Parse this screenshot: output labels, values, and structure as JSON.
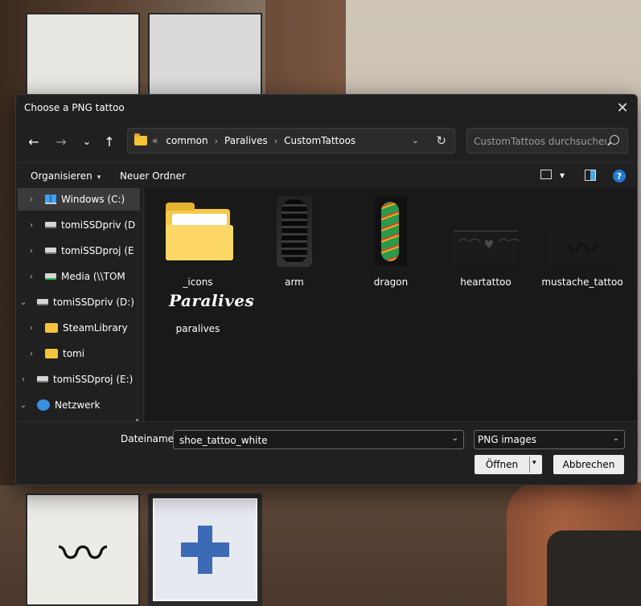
{
  "dialog": {
    "title": "Choose a PNG tattoo",
    "close_glyph": "✕"
  },
  "nav": {
    "back_glyph": "←",
    "forward_glyph": "→",
    "recent_glyph": "⌄",
    "up_glyph": "↑",
    "overflow": "«",
    "breadcrumb": [
      "common",
      "Paralives",
      "CustomTattoos"
    ],
    "breadcrumb_sep": "›",
    "refresh_glyph": "↻",
    "dropdown_glyph": "⌄",
    "search_placeholder": "CustomTattoos durchsuchen"
  },
  "toolbar": {
    "organize": "Organisieren",
    "new_folder": "Neuer Ordner",
    "caret": "▾"
  },
  "sidebar": {
    "items": [
      {
        "label": "Windows (C:)",
        "icon": "windows-drive-icon",
        "expander": "›"
      },
      {
        "label": "tomiSSDpriv (D",
        "icon": "drive-icon",
        "expander": "›"
      },
      {
        "label": "tomiSSDproj (E",
        "icon": "drive-icon",
        "expander": "›"
      },
      {
        "label": "Media (\\\\TOM",
        "icon": "network-drive-icon",
        "expander": "›"
      },
      {
        "label": "tomiSSDpriv (D:)",
        "icon": "drive-icon",
        "expander": "⌄"
      },
      {
        "label": "SteamLibrary",
        "icon": "folder-icon",
        "expander": "›"
      },
      {
        "label": "tomi",
        "icon": "folder-icon",
        "expander": "›"
      },
      {
        "label": "tomiSSDproj (E:)",
        "icon": "drive-icon",
        "expander": "›"
      },
      {
        "label": "Netzwerk",
        "icon": "network-icon",
        "expander": "⌄"
      }
    ]
  },
  "files": [
    {
      "name": "_icons",
      "kind": "folder"
    },
    {
      "name": "arm",
      "kind": "png"
    },
    {
      "name": "dragon",
      "kind": "png"
    },
    {
      "name": "heartattoo",
      "kind": "png"
    },
    {
      "name": "mustache_tattoo",
      "kind": "png"
    },
    {
      "name": "paralives",
      "kind": "png",
      "logo_text": "Paralives"
    }
  ],
  "footer": {
    "filename_label": "Dateiname:",
    "filename_value": "shoe_tattoo_white",
    "filetype": "PNG images",
    "open": "Öffnen",
    "cancel": "Abbrechen",
    "dropdown_glyph": "⌄",
    "split_glyph": "▾"
  },
  "colors": {
    "dialog_bg": "#202020",
    "files_bg": "#191919",
    "accent": "#1f7bd0",
    "folder": "#f7c948"
  }
}
